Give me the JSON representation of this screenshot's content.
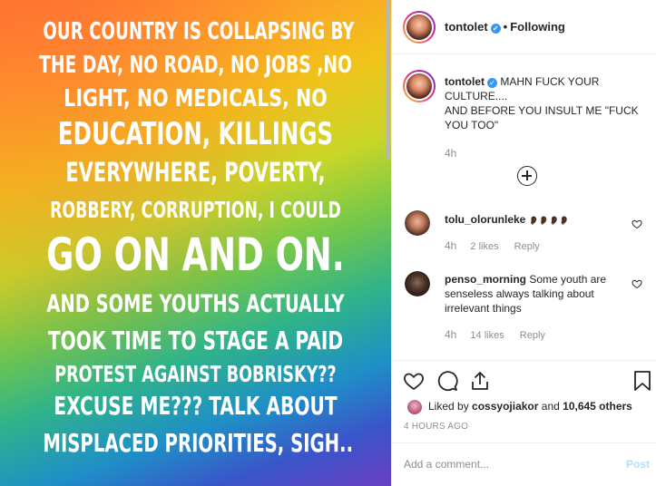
{
  "story": {
    "lines": [
      "OUR COUNTRY IS COLLAPSING BY",
      "THE DAY, NO ROAD, NO JOBS ,NO",
      "LIGHT,  NO MEDICALS, NO",
      "EDUCATION, KILLINGS",
      "EVERYWHERE, POVERTY,",
      "ROBBERY, CORRUPTION, I COULD",
      "GO ON AND ON.",
      "AND SOME YOUTHS ACTUALLY",
      "TOOK TIME TO STAGE A PAID",
      "PROTEST AGAINST BOBRISKY??",
      "EXCUSE ME??? TALK ABOUT",
      "MISPLACED PRIORITIES, SIGH.."
    ]
  },
  "header": {
    "username": "tontolet",
    "follow_status": "Following",
    "separator": "•"
  },
  "caption": {
    "username": "tontolet",
    "text": "MAHN FUCK YOUR CULTURE....\nAND BEFORE YOU INSULT ME \"FUCK YOU TOO\"",
    "time": "4h"
  },
  "comments": [
    {
      "username": "tolu_olorunleke",
      "text": "👂🏿👂🏿👂🏿👂🏿",
      "time": "4h",
      "likes": "2 likes",
      "reply": "Reply"
    },
    {
      "username": "penso_morning",
      "text": "Some youth are senseless always talking about irrelevant things",
      "time": "4h",
      "likes": "14 likes",
      "reply": "Reply"
    }
  ],
  "likes": {
    "prefix": "Liked by",
    "user": "cossyojiakor",
    "conj": "and",
    "others": "10,645 others"
  },
  "timestamp": "4 HOURS AGO",
  "composer": {
    "placeholder": "Add a comment...",
    "post_label": "Post"
  },
  "colors": {
    "verified": "#3897f0",
    "post_disabled": "#b2dffc",
    "meta": "#8e8e8e"
  }
}
